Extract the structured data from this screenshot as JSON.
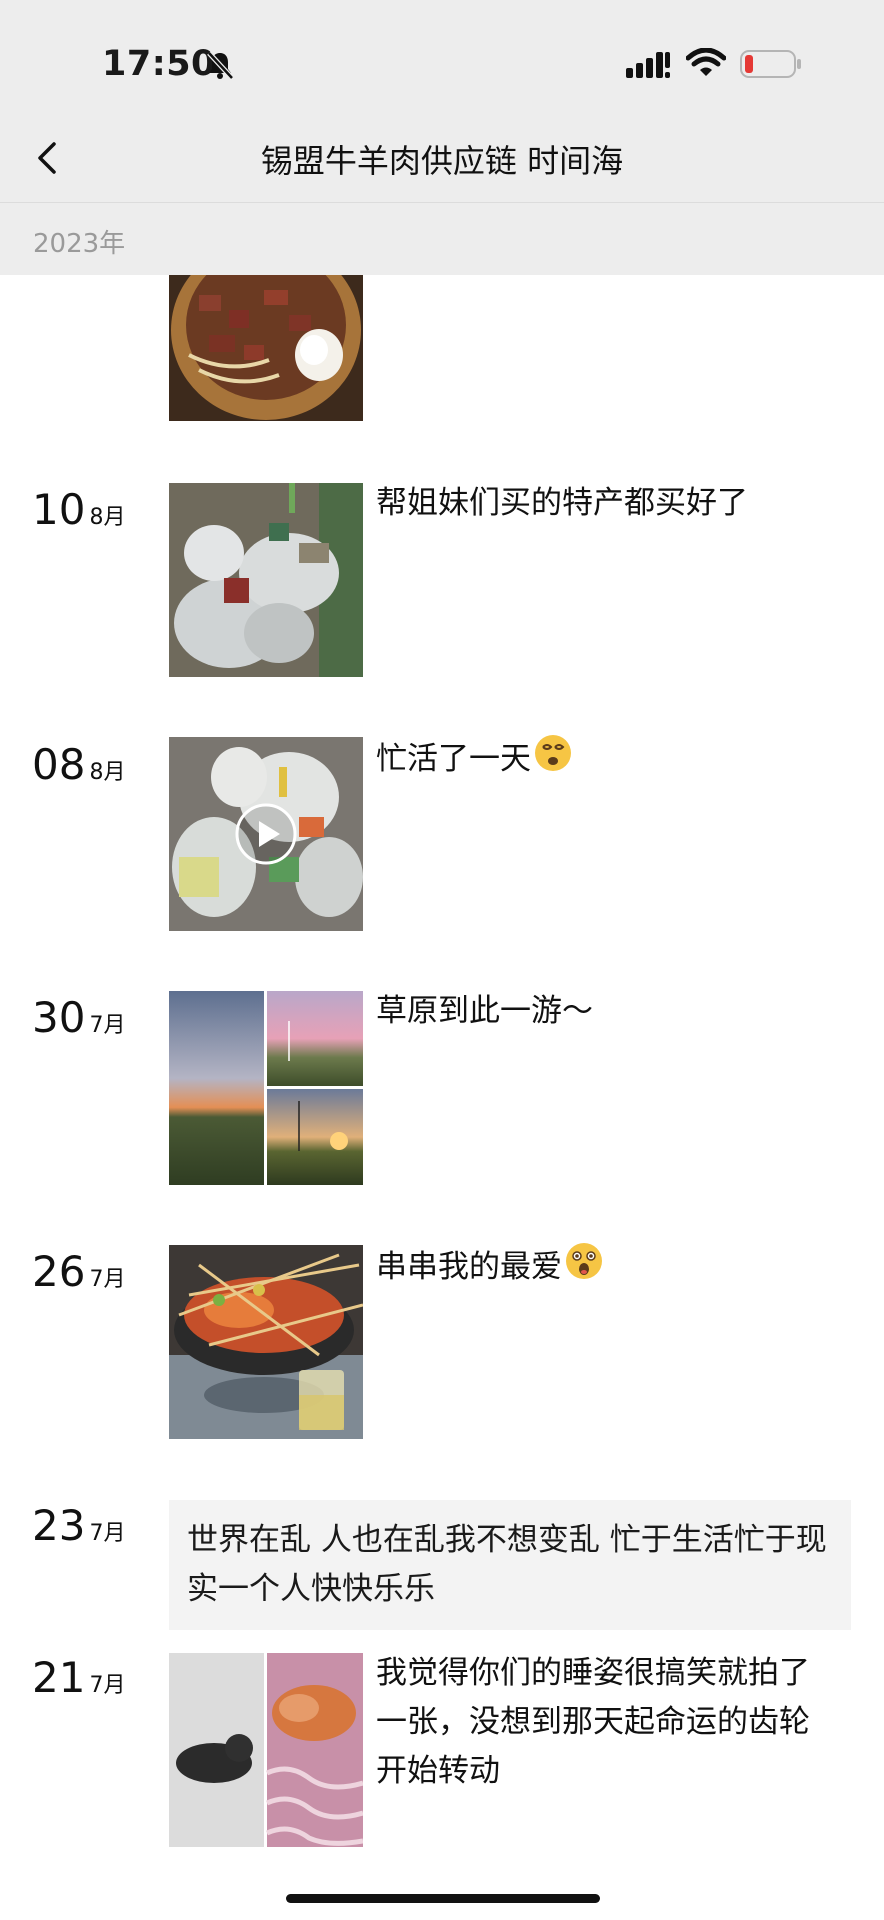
{
  "status": {
    "time": "17:50"
  },
  "header": {
    "title": "锡盟牛羊肉供应链  时间海",
    "year": "2023年"
  },
  "posts": [
    {
      "day": "10",
      "month": "8月",
      "text": "帮姐妹们买的特产都买好了"
    },
    {
      "day": "08",
      "month": "8月",
      "text": "忙活了一天"
    },
    {
      "day": "30",
      "month": "7月",
      "text": "草原到此一游～"
    },
    {
      "day": "26",
      "month": "7月",
      "text": "串串我的最爱"
    },
    {
      "day": "23",
      "month": "7月",
      "text": "世界在乱 人也在乱我不想变乱 忙于生活忙于现实一个人快快乐乐"
    },
    {
      "day": "21",
      "month": "7月",
      "text": "我觉得你们的睡姿很搞笑就拍了一张，没想到那天起命运的齿轮开始转动"
    }
  ],
  "icons": [
    "bell-slash-icon",
    "signal-icon",
    "wifi-icon",
    "battery-icon",
    "back-chevron-icon",
    "play-icon",
    "dizzy-face-emoji",
    "surprised-face-emoji"
  ],
  "colors": {
    "bar_bg": "#ededed",
    "battery_low": "#e53935",
    "text_box_bg": "#f3f3f3"
  }
}
